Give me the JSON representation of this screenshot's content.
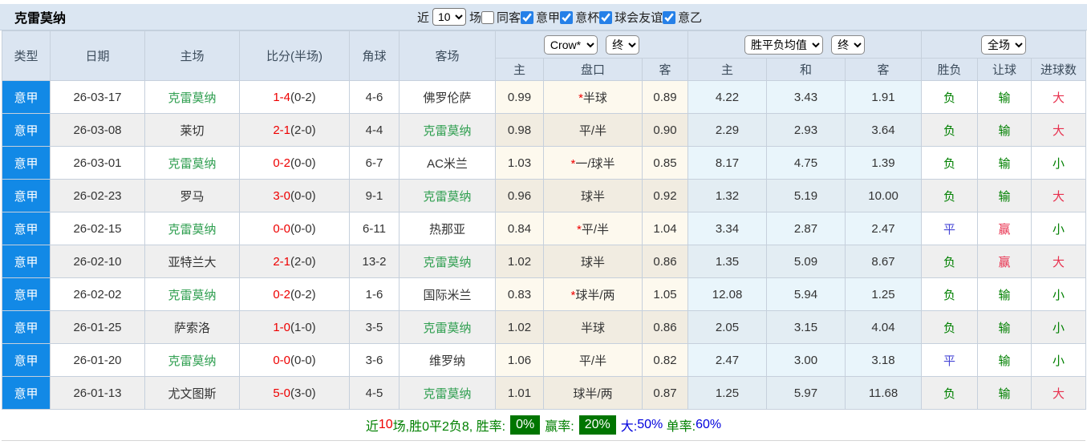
{
  "title": "克雷莫纳",
  "topbar": {
    "recent_label": "近",
    "recent_value": "10",
    "games_label": "场",
    "filters": [
      {
        "label": "同客",
        "checked": false
      },
      {
        "label": "意甲",
        "checked": true
      },
      {
        "label": "意杯",
        "checked": true
      },
      {
        "label": "球会友谊",
        "checked": true
      },
      {
        "label": "意乙",
        "checked": true
      }
    ]
  },
  "header": {
    "base_cols": [
      "类型",
      "日期",
      "主场",
      "比分(半场)",
      "角球",
      "客场"
    ],
    "odds_company_select": "Crow*",
    "odds_time_select": "终",
    "odds_cols": [
      "主",
      "盘口",
      "客"
    ],
    "avg_type_select": "胜平负均值",
    "avg_time_select": "终",
    "avg_cols": [
      "主",
      "和",
      "客"
    ],
    "scope_select": "全场",
    "result_cols": [
      "胜负",
      "让球",
      "进球数"
    ]
  },
  "rows": [
    {
      "league": "意甲",
      "date": "26-03-17",
      "home": "克雷莫纳",
      "home_highlight": true,
      "ft": "1-4",
      "ht": "(0-2)",
      "corners": "4-6",
      "away": "佛罗伦萨",
      "away_highlight": false,
      "odds_home": "0.99",
      "handicap_star": true,
      "handicap": "半球",
      "odds_away": "0.89",
      "avg_home": "4.22",
      "avg_draw": "3.43",
      "avg_away": "1.91",
      "wdl": "负",
      "wdl_color": "green",
      "cover": "输",
      "cover_color": "green",
      "goals": "大",
      "goals_color": "red"
    },
    {
      "league": "意甲",
      "date": "26-03-08",
      "home": "莱切",
      "home_highlight": false,
      "ft": "2-1",
      "ht": "(2-0)",
      "corners": "4-4",
      "away": "克雷莫纳",
      "away_highlight": true,
      "odds_home": "0.98",
      "handicap_star": false,
      "handicap": "平/半",
      "odds_away": "0.90",
      "avg_home": "2.29",
      "avg_draw": "2.93",
      "avg_away": "3.64",
      "wdl": "负",
      "wdl_color": "green",
      "cover": "输",
      "cover_color": "green",
      "goals": "大",
      "goals_color": "red"
    },
    {
      "league": "意甲",
      "date": "26-03-01",
      "home": "克雷莫纳",
      "home_highlight": true,
      "ft": "0-2",
      "ht": "(0-0)",
      "corners": "6-7",
      "away": "AC米兰",
      "away_highlight": false,
      "odds_home": "1.03",
      "handicap_star": true,
      "handicap": "一/球半",
      "odds_away": "0.85",
      "avg_home": "8.17",
      "avg_draw": "4.75",
      "avg_away": "1.39",
      "wdl": "负",
      "wdl_color": "green",
      "cover": "输",
      "cover_color": "green",
      "goals": "小",
      "goals_color": "green"
    },
    {
      "league": "意甲",
      "date": "26-02-23",
      "home": "罗马",
      "home_highlight": false,
      "ft": "3-0",
      "ht": "(0-0)",
      "corners": "9-1",
      "away": "克雷莫纳",
      "away_highlight": true,
      "odds_home": "0.96",
      "handicap_star": false,
      "handicap": "球半",
      "odds_away": "0.92",
      "avg_home": "1.32",
      "avg_draw": "5.19",
      "avg_away": "10.00",
      "wdl": "负",
      "wdl_color": "green",
      "cover": "输",
      "cover_color": "green",
      "goals": "大",
      "goals_color": "red"
    },
    {
      "league": "意甲",
      "date": "26-02-15",
      "home": "克雷莫纳",
      "home_highlight": true,
      "ft": "0-0",
      "ht": "(0-0)",
      "corners": "6-11",
      "away": "热那亚",
      "away_highlight": false,
      "odds_home": "0.84",
      "handicap_star": true,
      "handicap": "平/半",
      "odds_away": "1.04",
      "avg_home": "3.34",
      "avg_draw": "2.87",
      "avg_away": "2.47",
      "wdl": "平",
      "wdl_color": "blue",
      "cover": "赢",
      "cover_color": "red",
      "goals": "小",
      "goals_color": "green"
    },
    {
      "league": "意甲",
      "date": "26-02-10",
      "home": "亚特兰大",
      "home_highlight": false,
      "ft": "2-1",
      "ht": "(2-0)",
      "corners": "13-2",
      "away": "克雷莫纳",
      "away_highlight": true,
      "odds_home": "1.02",
      "handicap_star": false,
      "handicap": "球半",
      "odds_away": "0.86",
      "avg_home": "1.35",
      "avg_draw": "5.09",
      "avg_away": "8.67",
      "wdl": "负",
      "wdl_color": "green",
      "cover": "赢",
      "cover_color": "red",
      "goals": "大",
      "goals_color": "red"
    },
    {
      "league": "意甲",
      "date": "26-02-02",
      "home": "克雷莫纳",
      "home_highlight": true,
      "ft": "0-2",
      "ht": "(0-2)",
      "corners": "1-6",
      "away": "国际米兰",
      "away_highlight": false,
      "odds_home": "0.83",
      "handicap_star": true,
      "handicap": "球半/两",
      "odds_away": "1.05",
      "avg_home": "12.08",
      "avg_draw": "5.94",
      "avg_away": "1.25",
      "wdl": "负",
      "wdl_color": "green",
      "cover": "输",
      "cover_color": "green",
      "goals": "小",
      "goals_color": "green"
    },
    {
      "league": "意甲",
      "date": "26-01-25",
      "home": "萨索洛",
      "home_highlight": false,
      "ft": "1-0",
      "ht": "(1-0)",
      "corners": "3-5",
      "away": "克雷莫纳",
      "away_highlight": true,
      "odds_home": "1.02",
      "handicap_star": false,
      "handicap": "半球",
      "odds_away": "0.86",
      "avg_home": "2.05",
      "avg_draw": "3.15",
      "avg_away": "4.04",
      "wdl": "负",
      "wdl_color": "green",
      "cover": "输",
      "cover_color": "green",
      "goals": "小",
      "goals_color": "green"
    },
    {
      "league": "意甲",
      "date": "26-01-20",
      "home": "克雷莫纳",
      "home_highlight": true,
      "ft": "0-0",
      "ht": "(0-0)",
      "corners": "3-6",
      "away": "维罗纳",
      "away_highlight": false,
      "odds_home": "1.06",
      "handicap_star": false,
      "handicap": "平/半",
      "odds_away": "0.82",
      "avg_home": "2.47",
      "avg_draw": "3.00",
      "avg_away": "3.18",
      "wdl": "平",
      "wdl_color": "blue",
      "cover": "输",
      "cover_color": "green",
      "goals": "小",
      "goals_color": "green"
    },
    {
      "league": "意甲",
      "date": "26-01-13",
      "home": "尤文图斯",
      "home_highlight": false,
      "ft": "5-0",
      "ht": "(3-0)",
      "corners": "4-5",
      "away": "克雷莫纳",
      "away_highlight": true,
      "odds_home": "1.01",
      "handicap_star": false,
      "handicap": "球半/两",
      "odds_away": "0.87",
      "avg_home": "1.25",
      "avg_draw": "5.97",
      "avg_away": "11.68",
      "wdl": "负",
      "wdl_color": "green",
      "cover": "输",
      "cover_color": "green",
      "goals": "大",
      "goals_color": "red"
    }
  ],
  "footer": {
    "recent_label": "近",
    "recent_count": "10",
    "summary": "场,胜0平2负8, 胜率:",
    "win_rate": "0%",
    "cover_label": "赢率:",
    "cover_rate": "20%",
    "big_label": "大:",
    "big_rate": "50%",
    "single_label": "单率:",
    "single_rate": "60%"
  },
  "colors": {
    "accent_blue": "#1289e6",
    "team_green": "#2e9e4f",
    "score_red": "#ee0000",
    "result_green": "#008000",
    "result_blue": "#4747d6",
    "result_red": "#e8304e",
    "badge_green": "#007500",
    "footer_blue": "#0000dd"
  }
}
